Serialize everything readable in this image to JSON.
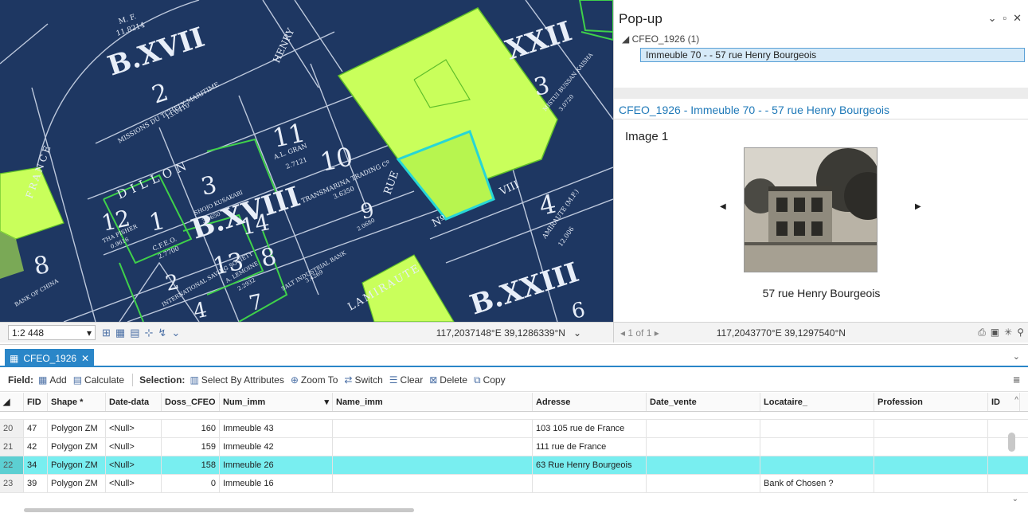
{
  "map": {
    "labels": {
      "bxvii": "B.XVII",
      "two": "2",
      "missions": "MISSIONS DU TCHELY MARITIME",
      "missions_area": "13.0410",
      "mf_top": "M. F.",
      "mf_top_area": "11.8214",
      "henry": "HENRY",
      "dillon": "DILLON",
      "france": "FRANCE",
      "eleven": "11",
      "algran": "A.L. GRAN",
      "algran_area": "2.7121",
      "ten": "10",
      "transmarina": "TRANSMARINA TRADING Cº",
      "transmarina_area": "3.6350",
      "three": "3",
      "kusakari": "SHOJO KUSAKARI",
      "kusakari_area": "3.0650",
      "bxviii": "B.XVIII",
      "twelve": "12",
      "one": "1",
      "cfeo": "C.F.E.O.",
      "cfeo_area": "2.7700",
      "thafisher": "THA FISHER",
      "thafisher_area": "0.9616",
      "thirteen": "13",
      "fourteen": "14",
      "lemoine": "A. LEMOINE",
      "lemoine_area": "2.2932",
      "eight": "8",
      "saltbank": "SALT INDUSTRIAL BANK",
      "saltbank_area": "3.4269",
      "nine": "9",
      "nine_area": "2.0680",
      "rue": "RUE",
      "no": "Nº",
      "viii": "VIII",
      "four": "4",
      "amirauté": "AMIRAUTE (M.F.)",
      "amirauté_area": "12.006",
      "lamiraute": "LAMIRAUTE",
      "bxxiii": "B.XXIII",
      "six": "6",
      "xxii": "XXII",
      "three_r": "3",
      "mistui": "MISTUI BUSSAN KAISHA",
      "mistui_area": "3.0720",
      "seven": "7",
      "eight_l": "8",
      "bankchina": "BANK OF CHINA",
      "intl": "INTERNATIONAL SAVING SOCIETY",
      "two_b": "2",
      "four_b": "4"
    }
  },
  "map_status": {
    "scale": "1:2 448",
    "coords": "117,2037148°E 39,1286339°N"
  },
  "popup": {
    "title": "Pop-up",
    "layer_group": "CFEO_1926 (1)",
    "selected_item": "Immeuble 70 -   - 57 rue Henry Bourgeois",
    "feature_title": "CFEO_1926 - Immeuble 70 -   - 57 rue Henry Bourgeois",
    "media_label": "Image 1",
    "media_caption": "57 rue Henry Bourgeois",
    "pager": "1 of 1",
    "coords": "117,2043770°E 39,1297540°N"
  },
  "table": {
    "tab_label": "CFEO_1926",
    "toolbar": {
      "field_label": "Field:",
      "add": "Add",
      "calculate": "Calculate",
      "selection_label": "Selection:",
      "select_by_attributes": "Select By Attributes",
      "zoom_to": "Zoom To",
      "switch": "Switch",
      "clear": "Clear",
      "delete": "Delete",
      "copy": "Copy"
    },
    "columns": [
      "FID",
      "Shape *",
      "Date-data",
      "Doss_CFEO",
      "Num_imm",
      "Name_imm",
      "Adresse",
      "Date_vente",
      "Locataire_",
      "Profession",
      "ID"
    ],
    "rows": [
      {
        "n": "20",
        "fid": "47",
        "shape": "Polygon ZM",
        "date": "<Null>",
        "doss": "160",
        "num": "Immeuble 43",
        "name": "",
        "adresse": "103 105 rue de France",
        "vente": "",
        "loc": "",
        "prof": ""
      },
      {
        "n": "21",
        "fid": "42",
        "shape": "Polygon ZM",
        "date": "<Null>",
        "doss": "159",
        "num": "Immeuble 42",
        "name": "",
        "adresse": "111 rue de France",
        "vente": "",
        "loc": "",
        "prof": ""
      },
      {
        "n": "22",
        "fid": "34",
        "shape": "Polygon ZM",
        "date": "<Null>",
        "doss": "158",
        "num": "Immeuble 26",
        "name": "",
        "adresse": "63 Rue Henry Bourgeois",
        "vente": "",
        "loc": "",
        "prof": ""
      },
      {
        "n": "23",
        "fid": "39",
        "shape": "Polygon ZM",
        "date": "<Null>",
        "doss": "0",
        "num": "Immeuble 16",
        "name": "",
        "adresse": "",
        "vente": "",
        "loc": "Bank of Chosen ?",
        "prof": ""
      }
    ]
  }
}
